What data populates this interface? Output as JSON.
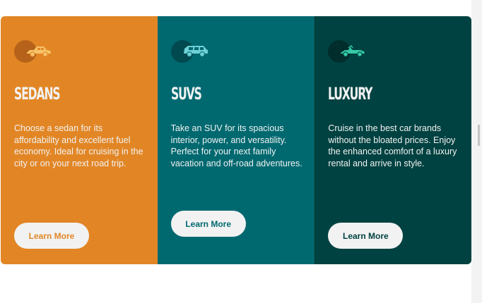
{
  "cards": [
    {
      "title": "SEDANS",
      "description": "Choose a sedan for its affordability and excellent fuel economy. Ideal for cruising in the city or on your next road trip.",
      "button_label": "Learn More",
      "icon": "sedan-car-icon",
      "bg_color": "#e28625",
      "accent_color": "#e28625"
    },
    {
      "title": "SUVS",
      "description": "Take an SUV for its spacious interior, power, and versatility. Perfect for your next family vacation and off-road adventures.",
      "button_label": "Learn More",
      "icon": "suv-car-icon",
      "bg_color": "#006970",
      "accent_color": "#006970"
    },
    {
      "title": "LUXURY",
      "description": "Cruise in the best car brands without the bloated prices. Enjoy the enhanced comfort of a luxury rental and arrive in style.",
      "button_label": "Learn More",
      "icon": "luxury-car-icon",
      "bg_color": "#004241",
      "accent_color": "#004241"
    }
  ]
}
